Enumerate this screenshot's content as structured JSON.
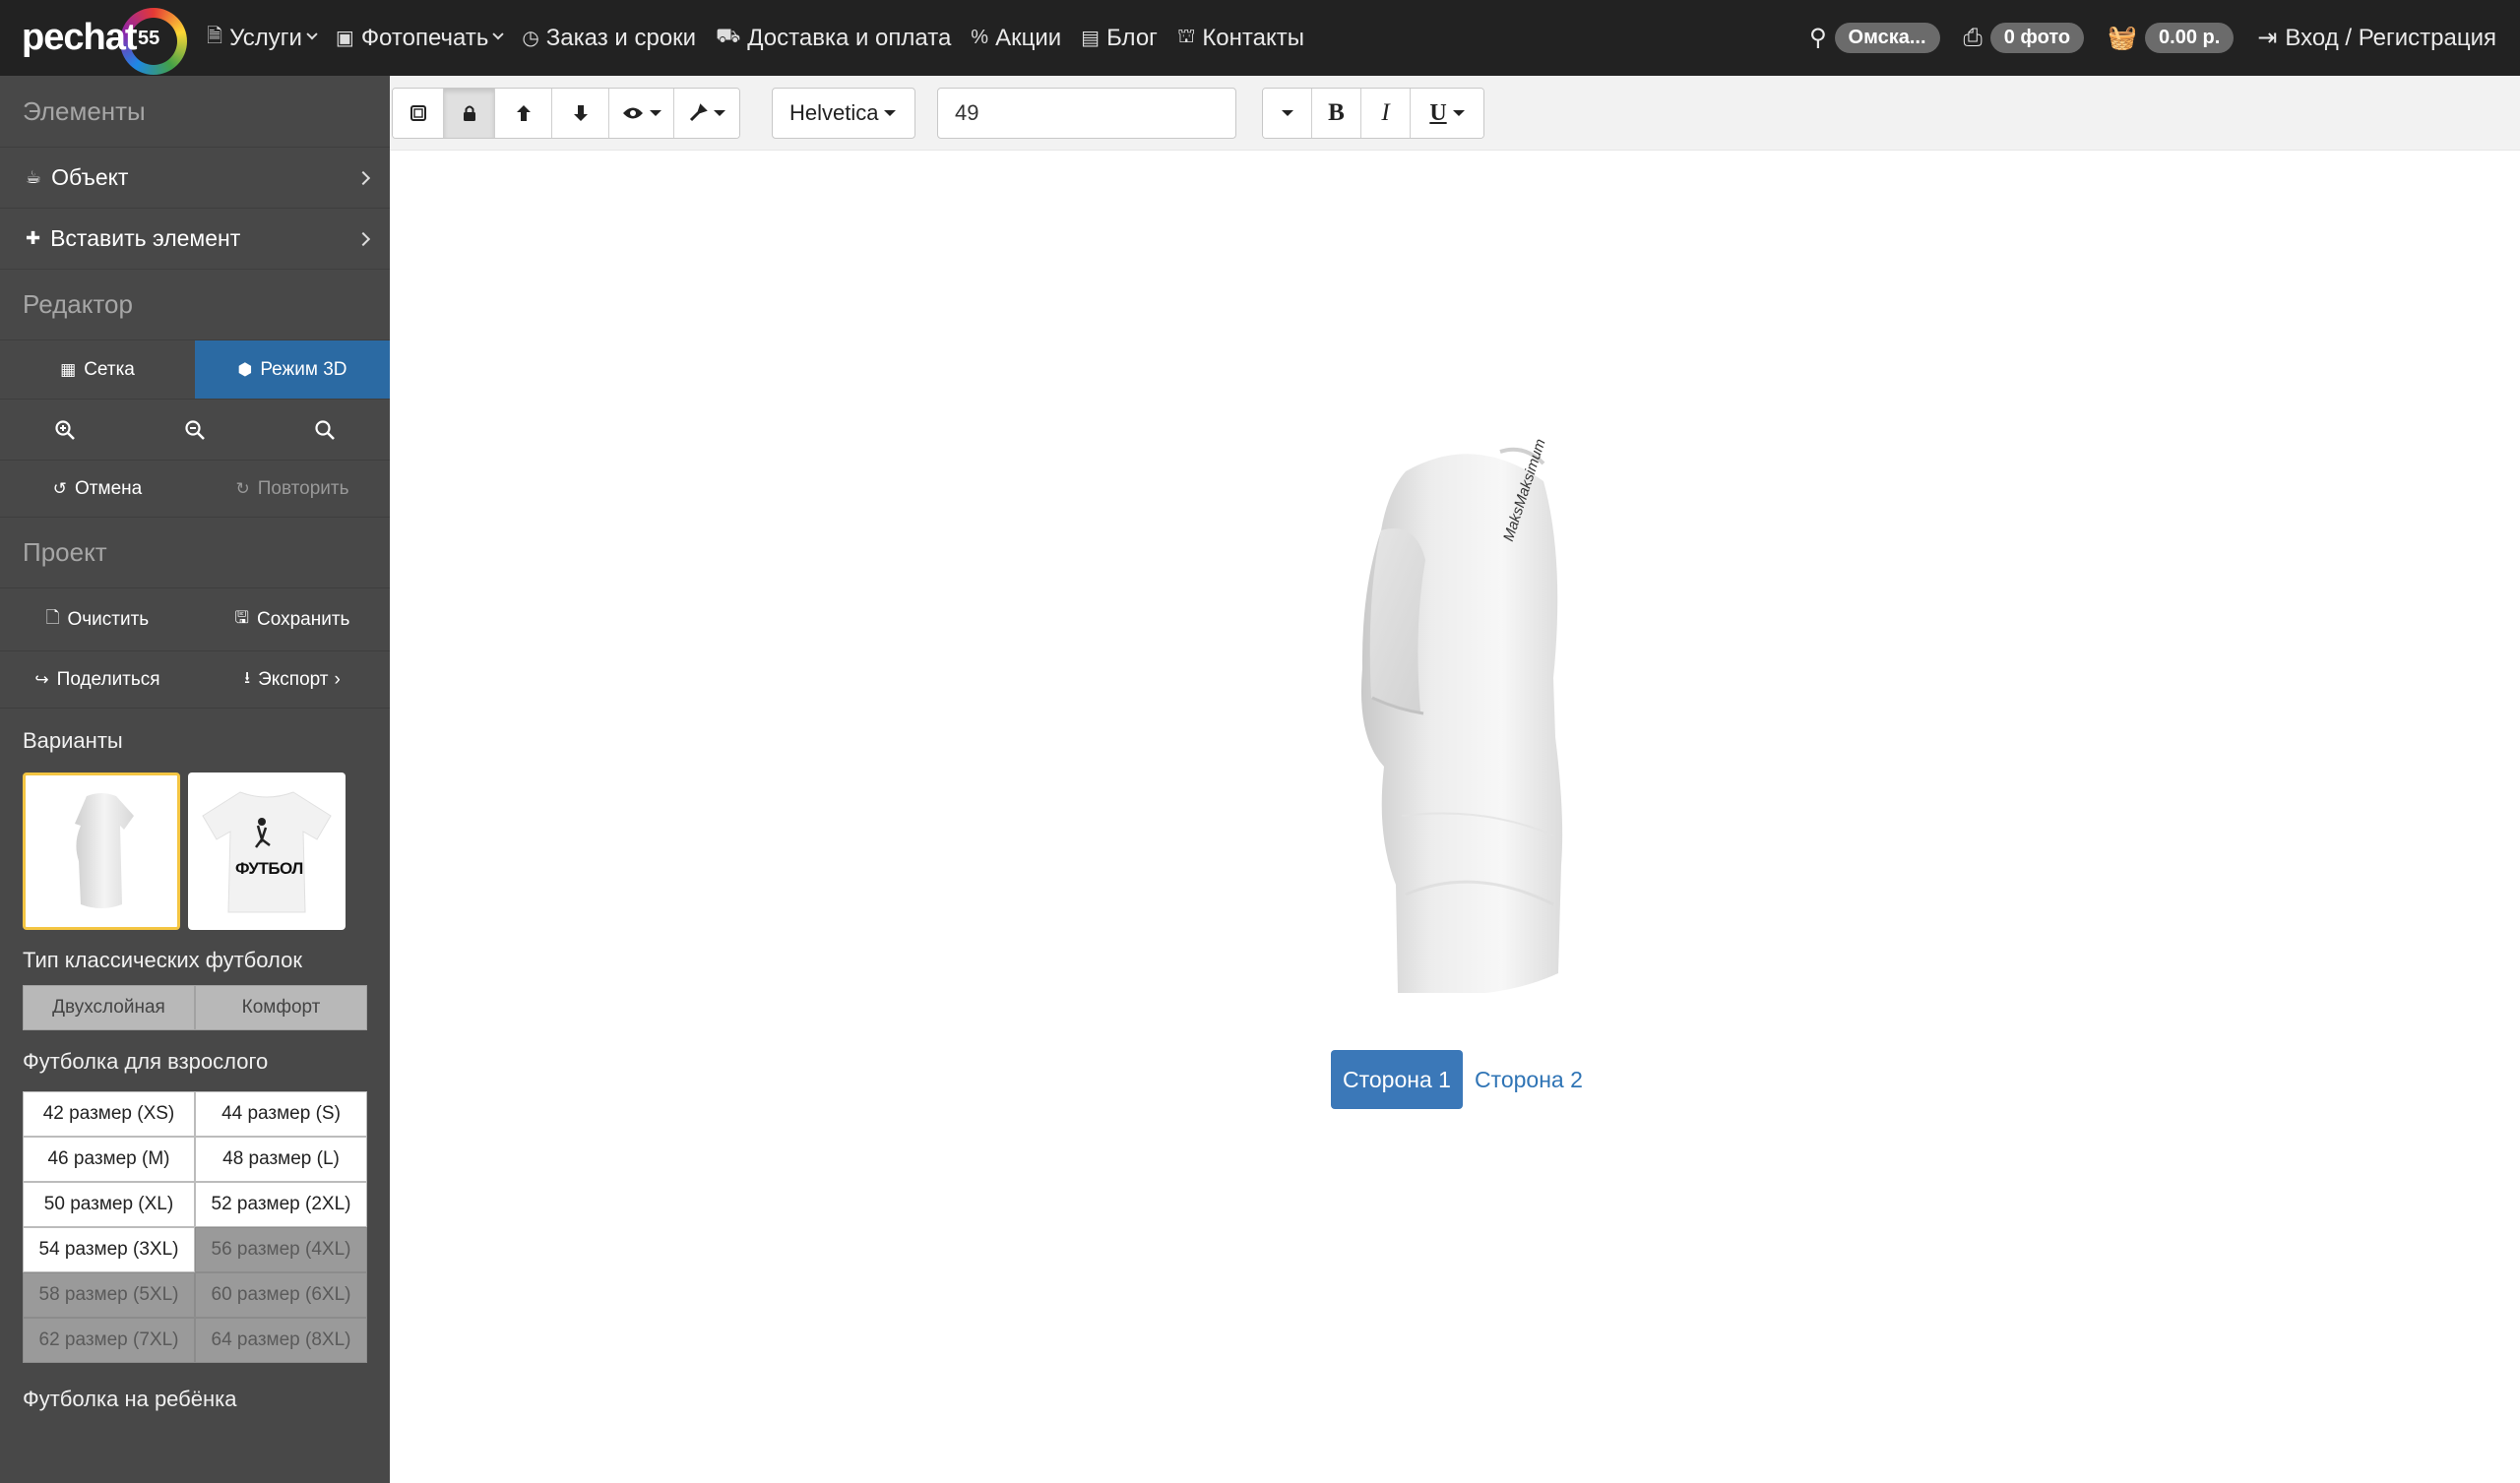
{
  "header": {
    "logo_text": "pechat",
    "logo_number": "55",
    "nav": [
      {
        "label": "Услуги",
        "icon": "document-icon",
        "dropdown": true
      },
      {
        "label": "Фотопечать",
        "icon": "camera-icon",
        "dropdown": true
      },
      {
        "label": "Заказ и сроки",
        "icon": "clock-icon",
        "dropdown": false
      },
      {
        "label": "Доставка и оплата",
        "icon": "car-icon",
        "dropdown": false
      },
      {
        "label": "Акции",
        "icon": "percent-icon",
        "dropdown": false
      },
      {
        "label": "Блог",
        "icon": "newspaper-icon",
        "dropdown": false
      },
      {
        "label": "Контакты",
        "icon": "sitemap-icon",
        "dropdown": false
      }
    ],
    "city": "Омска...",
    "photos": "0 фото",
    "cart": "0.00 р.",
    "login": "Вход / Регистрация"
  },
  "sidebar": {
    "elements_title": "Элементы",
    "object_label": "Объект",
    "insert_label": "Вставить элемент",
    "editor_title": "Редактор",
    "grid_label": "Сетка",
    "mode3d_label": "Режим 3D",
    "undo_label": "Отмена",
    "redo_label": "Повторить",
    "project_title": "Проект",
    "clear_label": "Очистить",
    "save_label": "Сохранить",
    "share_label": "Поделиться",
    "export_label": "Экспорт",
    "variants_title": "Варианты",
    "variant2_print": "ФУТБОЛ",
    "type_title": "Тип классических футболок",
    "types": [
      "Двухслойная",
      "Комфорт"
    ],
    "adult_title": "Футболка для взрослого",
    "sizes": [
      {
        "label": "42 размер (XS)",
        "enabled": true
      },
      {
        "label": "44 размер (S)",
        "enabled": true
      },
      {
        "label": "46 размер (M)",
        "enabled": true
      },
      {
        "label": "48 размер (L)",
        "enabled": true
      },
      {
        "label": "50 размер (XL)",
        "enabled": true
      },
      {
        "label": "52 размер (2XL)",
        "enabled": true
      },
      {
        "label": "54 размер (3XL)",
        "enabled": true
      },
      {
        "label": "56 размер (4XL)",
        "enabled": false
      },
      {
        "label": "58 размер (5XL)",
        "enabled": false
      },
      {
        "label": "60 размер (6XL)",
        "enabled": false
      },
      {
        "label": "62 размер (7XL)",
        "enabled": false
      },
      {
        "label": "64 размер (8XL)",
        "enabled": false
      }
    ],
    "child_title": "Футболка на ребёнка"
  },
  "toolbar": {
    "font": "Helvetica",
    "font_size": "49",
    "bold": "B",
    "italic": "I",
    "underline": "U"
  },
  "canvas": {
    "shirt_print": "MaksMaksimum",
    "side1": "Сторона 1",
    "side2": "Сторона 2"
  },
  "colors": {
    "navbar": "#222222",
    "sidebar": "#484848",
    "accent_blue": "#2b6aa3",
    "selected_border": "#f4c542"
  }
}
